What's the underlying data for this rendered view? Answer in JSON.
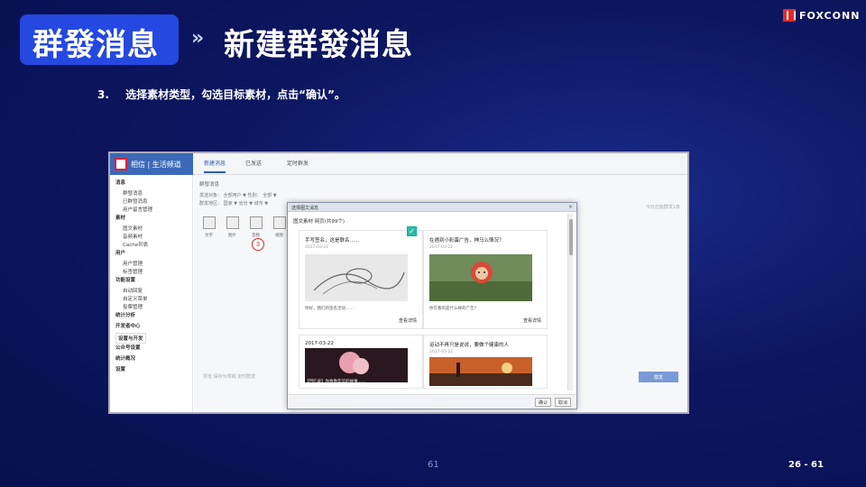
{
  "slide": {
    "title_main": "群發消息",
    "title_arrows": "»",
    "title_sub": "新建群發消息",
    "logo_text": "FOXCONN",
    "step_num": "3.",
    "step_text": "选择素材类型，勾选目标素材，点击“确认”。",
    "page_center": "61",
    "page_ref": "26 - 61"
  },
  "app": {
    "brand": "相信 | 生活频道",
    "tabs": [
      "新建消息",
      "已发送",
      "定时群发"
    ],
    "sidebar": [
      {
        "label": "消息",
        "group": true
      },
      {
        "label": "群發消息"
      },
      {
        "label": "已群發消息"
      },
      {
        "label": "用户留言管理"
      },
      {
        "label": "素材",
        "group": true
      },
      {
        "label": "图文素材"
      },
      {
        "label": "音频素材"
      },
      {
        "label": "Cache列表"
      },
      {
        "label": "用户",
        "group": true
      },
      {
        "label": "用户管理"
      },
      {
        "label": "标签管理"
      },
      {
        "label": "功能设置",
        "group": true
      },
      {
        "label": "自动回复"
      },
      {
        "label": "自定义菜单"
      },
      {
        "label": "投票管理"
      },
      {
        "label": "统计分析",
        "group": true
      },
      {
        "label": "开发者中心",
        "group": true
      },
      {
        "label": "设置与开发",
        "group": true,
        "highlight": true
      },
      {
        "label": "公众号设置",
        "group": true
      },
      {
        "label": "统计概况",
        "group": true
      },
      {
        "label": "设置",
        "group": true
      }
    ],
    "crumb": "群發消息",
    "filter_line1": "发送对象： 全部用户 ▼   性别： 全部 ▼",
    "filter_line2": "群发地区： 国家 ▼   省份 ▼   城市 ▼",
    "faint_hint": "今日还能群发1条",
    "tools": [
      "文字",
      "图片",
      "音频",
      "视频"
    ],
    "step_badge": "3",
    "bottom_text": "预览   保存为草稿   定时群发",
    "send_label": "群发"
  },
  "modal": {
    "title": "选择图文消息",
    "close": "×",
    "tabs": "图文素材   网页(共99个)",
    "cards": [
      {
        "title": "手写签名，这是联名……",
        "date": "2017-03-21",
        "desc": "你好，我们的签名活动……",
        "link": "查看详情",
        "checked": true
      },
      {
        "title": "在遇到小彩蛋广告，神马么情况？",
        "date": "2017-03-21",
        "desc": "你在看的是什么样的广告？",
        "link": "查看详情",
        "checked": false
      },
      {
        "title": "2017-03-22",
        "date": "",
        "desc": "【回忆录】你青春年华的故事……",
        "link": "",
        "checked": false
      },
      {
        "title": "运动不再只是说说，要做个健康的人",
        "date": "2017-03-22",
        "desc": "",
        "link": "",
        "checked": false
      }
    ],
    "ok": "确认",
    "cancel": "取消"
  },
  "colors": {
    "accent": "#2548e0",
    "check": "#2bbba6",
    "badge": "#d22"
  }
}
